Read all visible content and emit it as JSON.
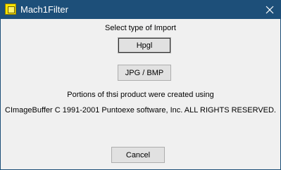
{
  "window": {
    "title": "Mach1Filter",
    "app_icon": "mach1-app-icon",
    "close_icon": "close-icon"
  },
  "dialog": {
    "prompt": "Select type of Import",
    "hpgl_label": "Hpgl",
    "jpg_bmp_label": "JPG / BMP",
    "notice_line1": "Portions of thsi product were created using",
    "notice_line2": "CImageBuffer C 1991-2001 Puntoexe software, Inc. ALL RIGHTS RESERVED.",
    "cancel_label": "Cancel"
  },
  "colors": {
    "titlebar": "#1d4f79",
    "background": "#f0f0f0",
    "button_face": "#e1e1e1"
  }
}
